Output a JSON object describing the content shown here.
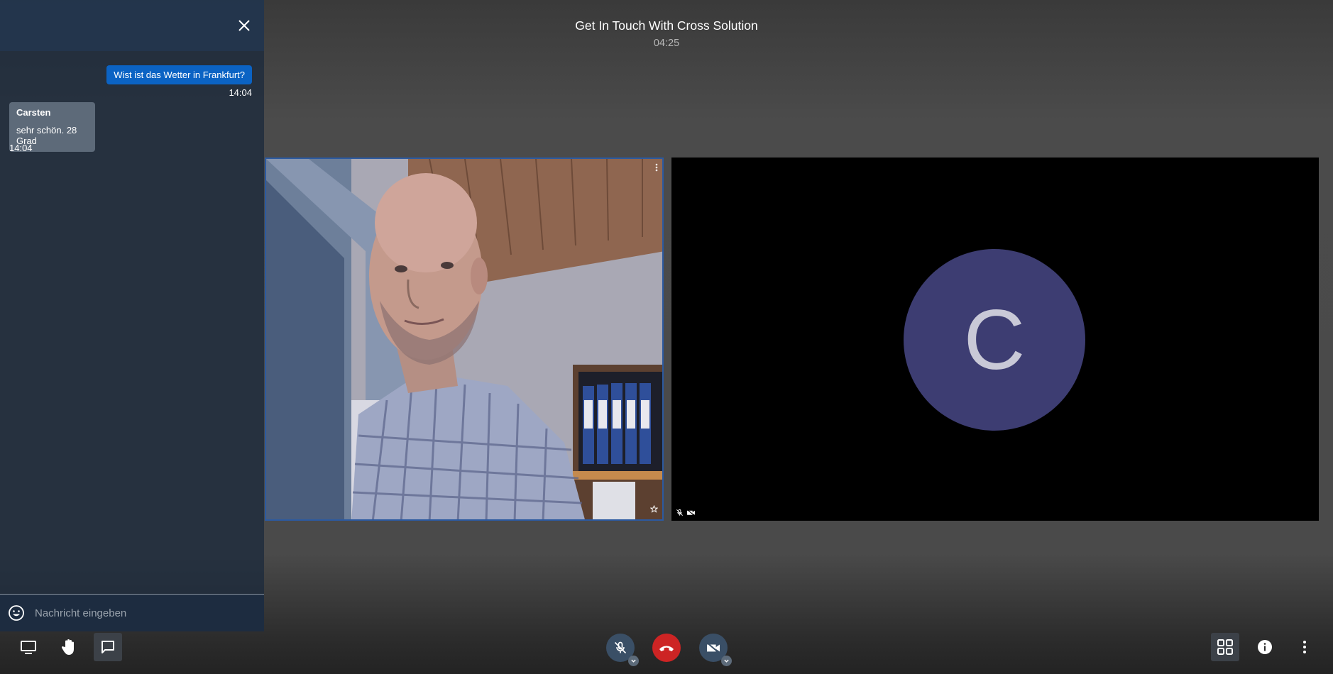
{
  "conference": {
    "title": "Get In Touch With Cross Solution",
    "timer": "04:25"
  },
  "chat": {
    "messages": [
      {
        "from": "me",
        "text": "Wist ist das Wetter in Frankfurt?",
        "time": "14:04"
      },
      {
        "from": "Carsten",
        "text": "sehr schön. 28 Grad",
        "time": "14:04"
      }
    ],
    "input_placeholder": "Nachricht eingeben"
  },
  "remote": {
    "avatar_letter": "C"
  },
  "toolbar": {
    "left": [
      "screen-share-icon",
      "raise-hand-icon",
      "chat-icon"
    ],
    "center": [
      "microphone-muted-icon",
      "hangup-icon",
      "camera-off-icon"
    ],
    "right": [
      "tile-view-icon",
      "info-icon",
      "more-options-icon"
    ]
  },
  "colors": {
    "hangup": "#cd2424",
    "own_message": "#0b63c4",
    "avatar": "#3d3d72",
    "active_border": "#2c5aa0"
  }
}
